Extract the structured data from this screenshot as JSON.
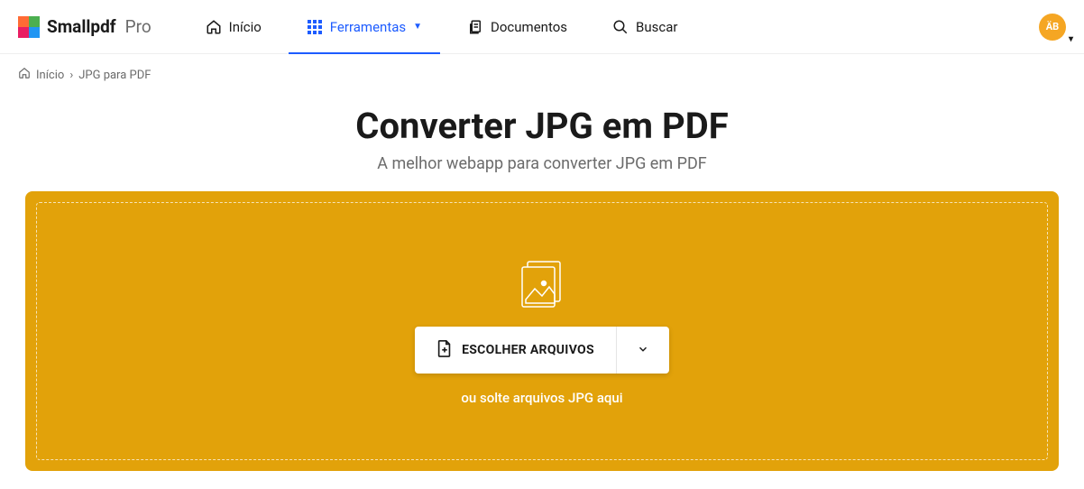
{
  "brand": {
    "name": "Smallpdf",
    "suffix": "Pro"
  },
  "nav": {
    "home": "Início",
    "tools": "Ferramentas",
    "documents": "Documentos",
    "search": "Buscar"
  },
  "avatar": {
    "initials": "ÄB"
  },
  "breadcrumb": {
    "home": "Início",
    "separator": "›",
    "current": "JPG para PDF"
  },
  "hero": {
    "title": "Converter JPG em PDF",
    "subtitle": "A melhor webapp para converter JPG em PDF"
  },
  "dropzone": {
    "button_label": "ESCOLHER ARQUIVOS",
    "hint": "ou solte arquivos JPG aqui"
  },
  "colors": {
    "accent": "#1d5cff",
    "dropzone_bg": "#e2a20a",
    "avatar_bg": "#f5a623"
  }
}
